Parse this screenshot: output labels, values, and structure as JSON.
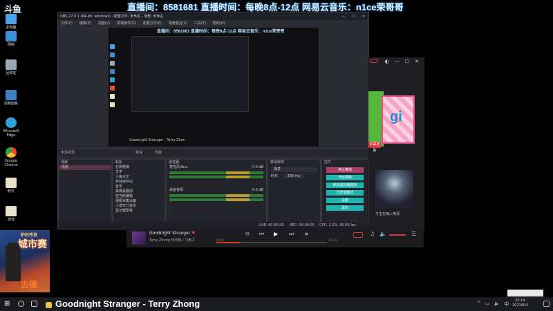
{
  "banner": {
    "logo": "斗鱼",
    "text": "直播间：8581681  直播时间：每晚8点-12点  网易云音乐：n1ce荣哥哥"
  },
  "desktop_icons": [
    {
      "label": "此电脑",
      "color": "#4aa3e8"
    },
    {
      "label": "网络",
      "color": "#3b8fd6"
    },
    {
      "label": "回收站",
      "color": "#9aa7b5"
    },
    {
      "label": "控制面板",
      "color": "#3c7fc2"
    },
    {
      "label": "Microsoft Edge",
      "color": "#2fa3d8"
    },
    {
      "label": "Google Chrome",
      "color": "#e84a3c"
    },
    {
      "label": "软件",
      "color": "#e8e2c8"
    },
    {
      "label": "游戏",
      "color": "#e8e2c8"
    }
  ],
  "camera": {
    "title": "炉石传说",
    "big": "城市赛",
    "name": "古德"
  },
  "obs": {
    "title": "OBS 27.0.1 (64-bit, windows) - 配置文件: 未命名 - 场景: 未命名",
    "menu": [
      "文件(F)",
      "编辑(E)",
      "视图(V)",
      "停靠部件(D)",
      "配置文件(P)",
      "场景集合(S)",
      "工具(T)",
      "帮助(H)"
    ],
    "preview_banner": "直播间：8581681 直播时间：每晚8点-12点 网易云音乐：n1ce荣哥哥",
    "preview_caption": "Goodnight Stranger - Terry Zhon",
    "context_label": "未选择源",
    "context_buttons": [
      "属性",
      "滤镜"
    ],
    "docks": {
      "scenes": {
        "title": "场景",
        "items": [
          "场景"
        ]
      },
      "sources": {
        "title": "来源",
        "items": [
          "右侧铭牌",
          "文字",
          "斗鱼水印",
          "护目库存边",
          "音乐",
          "美狮黑叠加",
          "亚当斯编辑",
          "视频采集设备",
          "入侵开口音乐",
          "显示器录像",
          "游戏录像",
          "显示器采集"
        ]
      },
      "mixer": {
        "title": "混音器",
        "channels": [
          {
            "name": "麦克风/Aux",
            "db": "0.0 dB"
          },
          {
            "name": "桌面音频",
            "db": "0.0 dB"
          }
        ]
      },
      "transitions": {
        "title": "转场特效",
        "type": "渐变",
        "duration_label": "时长",
        "duration": "300 ms"
      },
      "controls": {
        "title": "控件",
        "buttons": [
          "停止推流",
          "开始录制",
          "启动虚拟摄像机",
          "工作室模式",
          "设置",
          "退出"
        ]
      }
    },
    "status": {
      "live": "LIVE: 00:00:00",
      "rec": "REC: 00:00:00",
      "cpu": "CPU: 1.2%, 60.00 fps"
    }
  },
  "music_player": {
    "song": "Goodnight Stranger",
    "artist": "Terry Zhong 林天和 / 习惠子",
    "time_left": "00:45",
    "time_right": "03:26"
  },
  "netease_panel": {
    "tag": "红黑皮肤",
    "caption": "今生无悔入电洞"
  },
  "taskbar": {
    "song": "Goodnight Stranger - Terry Zhong",
    "time": "20:14",
    "date": "2021/9/4"
  }
}
